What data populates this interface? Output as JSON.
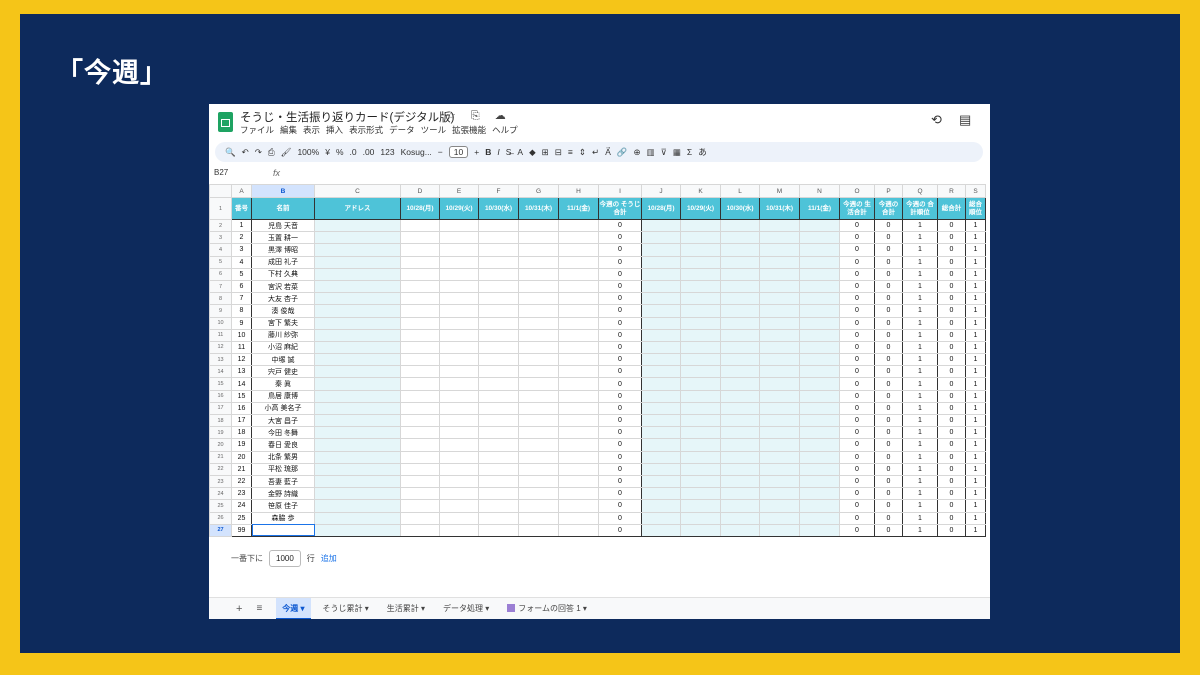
{
  "slide": {
    "title": "「今週」"
  },
  "doc": {
    "title": "そうじ・生活振り返りカード(デジタル版)",
    "title_icons": "☆ ⎘ ☁"
  },
  "menu": [
    "ファイル",
    "編集",
    "表示",
    "挿入",
    "表示形式",
    "データ",
    "ツール",
    "拡張機能",
    "ヘルプ"
  ],
  "toolbar": {
    "search": "🔍",
    "undo": "↶",
    "redo": "↷",
    "print": "⎙",
    "paint": "🖌",
    "zoom": "100%",
    "currency": "¥",
    "percent": "%",
    "dec_minus": ".0",
    "dec_plus": ".00",
    "num_fmt": "123",
    "font": "Kosug...",
    "minus": "−",
    "font_size": "10",
    "plus": "+",
    "bold": "B",
    "italic": "I",
    "strike": "S̶",
    "text_color": "A",
    "fill": "◆",
    "borders": "⊞",
    "merge": "⊟",
    "align": "≡",
    "valign": "⇕",
    "wrap": "↵",
    "rotate": "A⃗",
    "link": "🔗",
    "comment": "⊕",
    "chart": "▥",
    "filter": "⊽",
    "views": "▦",
    "sum": "Σ",
    "ime": "あ"
  },
  "namebox": "B27",
  "fx": "fx",
  "columns": [
    "A",
    "B",
    "C",
    "D",
    "E",
    "F",
    "G",
    "H",
    "I",
    "J",
    "K",
    "L",
    "M",
    "N",
    "O",
    "P",
    "Q",
    "R",
    "S"
  ],
  "headers": [
    "番号",
    "名前",
    "アドレス",
    "10/28(月)",
    "10/29(火)",
    "10/30(水)",
    "10/31(木)",
    "11/1(金)",
    "今週の そうじ合計",
    "10/28(月)",
    "10/29(火)",
    "10/30(水)",
    "10/31(木)",
    "11/1(金)",
    "今週の 生活合計",
    "今週の 合計",
    "今週の 合計順位",
    "総合計",
    "総合 順位"
  ],
  "rows": [
    {
      "rn": "2",
      "no": "1",
      "name": "児島 天音",
      "cl": "0",
      "lf": "0",
      "tot": "0",
      "rank": "1",
      "gt": "0",
      "grank": "1"
    },
    {
      "rn": "3",
      "no": "2",
      "name": "玉置 耕一",
      "cl": "0",
      "lf": "0",
      "tot": "0",
      "rank": "1",
      "gt": "0",
      "grank": "1"
    },
    {
      "rn": "4",
      "no": "3",
      "name": "黒澤 博昭",
      "cl": "0",
      "lf": "0",
      "tot": "0",
      "rank": "1",
      "gt": "0",
      "grank": "1"
    },
    {
      "rn": "5",
      "no": "4",
      "name": "成田 礼子",
      "cl": "0",
      "lf": "0",
      "tot": "0",
      "rank": "1",
      "gt": "0",
      "grank": "1"
    },
    {
      "rn": "6",
      "no": "5",
      "name": "下村 久典",
      "cl": "0",
      "lf": "0",
      "tot": "0",
      "rank": "1",
      "gt": "0",
      "grank": "1"
    },
    {
      "rn": "7",
      "no": "6",
      "name": "宮沢 若菜",
      "cl": "0",
      "lf": "0",
      "tot": "0",
      "rank": "1",
      "gt": "0",
      "grank": "1"
    },
    {
      "rn": "8",
      "no": "7",
      "name": "大友 杏子",
      "cl": "0",
      "lf": "0",
      "tot": "0",
      "rank": "1",
      "gt": "0",
      "grank": "1"
    },
    {
      "rn": "9",
      "no": "8",
      "name": "湊 俊哉",
      "cl": "0",
      "lf": "0",
      "tot": "0",
      "rank": "1",
      "gt": "0",
      "grank": "1"
    },
    {
      "rn": "10",
      "no": "9",
      "name": "宮下 繁夫",
      "cl": "0",
      "lf": "0",
      "tot": "0",
      "rank": "1",
      "gt": "0",
      "grank": "1"
    },
    {
      "rn": "11",
      "no": "10",
      "name": "藤川 紗弥",
      "cl": "0",
      "lf": "0",
      "tot": "0",
      "rank": "1",
      "gt": "0",
      "grank": "1"
    },
    {
      "rn": "12",
      "no": "11",
      "name": "小沼 麻紀",
      "cl": "0",
      "lf": "0",
      "tot": "0",
      "rank": "1",
      "gt": "0",
      "grank": "1"
    },
    {
      "rn": "13",
      "no": "12",
      "name": "中塚 誠",
      "cl": "0",
      "lf": "0",
      "tot": "0",
      "rank": "1",
      "gt": "0",
      "grank": "1"
    },
    {
      "rn": "14",
      "no": "13",
      "name": "宍戸 健史",
      "cl": "0",
      "lf": "0",
      "tot": "0",
      "rank": "1",
      "gt": "0",
      "grank": "1"
    },
    {
      "rn": "15",
      "no": "14",
      "name": "秦 眞",
      "cl": "0",
      "lf": "0",
      "tot": "0",
      "rank": "1",
      "gt": "0",
      "grank": "1"
    },
    {
      "rn": "16",
      "no": "15",
      "name": "鳥居 康博",
      "cl": "0",
      "lf": "0",
      "tot": "0",
      "rank": "1",
      "gt": "0",
      "grank": "1"
    },
    {
      "rn": "17",
      "no": "16",
      "name": "小高 美名子",
      "cl": "0",
      "lf": "0",
      "tot": "0",
      "rank": "1",
      "gt": "0",
      "grank": "1"
    },
    {
      "rn": "18",
      "no": "17",
      "name": "大宮 昌子",
      "cl": "0",
      "lf": "0",
      "tot": "0",
      "rank": "1",
      "gt": "0",
      "grank": "1"
    },
    {
      "rn": "19",
      "no": "18",
      "name": "今田 冬舞",
      "cl": "0",
      "lf": "0",
      "tot": "0",
      "rank": "1",
      "gt": "0",
      "grank": "1"
    },
    {
      "rn": "20",
      "no": "19",
      "name": "春日 愛良",
      "cl": "0",
      "lf": "0",
      "tot": "0",
      "rank": "1",
      "gt": "0",
      "grank": "1"
    },
    {
      "rn": "21",
      "no": "20",
      "name": "北条 繁男",
      "cl": "0",
      "lf": "0",
      "tot": "0",
      "rank": "1",
      "gt": "0",
      "grank": "1"
    },
    {
      "rn": "22",
      "no": "21",
      "name": "平松 琉那",
      "cl": "0",
      "lf": "0",
      "tot": "0",
      "rank": "1",
      "gt": "0",
      "grank": "1"
    },
    {
      "rn": "23",
      "no": "22",
      "name": "吾妻 藍子",
      "cl": "0",
      "lf": "0",
      "tot": "0",
      "rank": "1",
      "gt": "0",
      "grank": "1"
    },
    {
      "rn": "24",
      "no": "23",
      "name": "金野 詩織",
      "cl": "0",
      "lf": "0",
      "tot": "0",
      "rank": "1",
      "gt": "0",
      "grank": "1"
    },
    {
      "rn": "25",
      "no": "24",
      "name": "笹原 佳子",
      "cl": "0",
      "lf": "0",
      "tot": "0",
      "rank": "1",
      "gt": "0",
      "grank": "1"
    },
    {
      "rn": "26",
      "no": "25",
      "name": "森脇 歩",
      "cl": "0",
      "lf": "0",
      "tot": "0",
      "rank": "1",
      "gt": "0",
      "grank": "1"
    },
    {
      "rn": "27",
      "no": "99",
      "name": "",
      "cl": "0",
      "lf": "0",
      "tot": "0",
      "rank": "1",
      "gt": "0",
      "grank": "1"
    }
  ],
  "add_rows": {
    "prefix": "一番下に",
    "count": "1000",
    "unit": "行",
    "action": "追加"
  },
  "tabs": {
    "add": "+",
    "list": "≡",
    "items": [
      {
        "label": "今週 ▾",
        "active": true
      },
      {
        "label": "そうじ累計 ▾"
      },
      {
        "label": "生活累計 ▾"
      },
      {
        "label": "データ処理 ▾"
      },
      {
        "label": "フォームの回答 1 ▾",
        "icon": true
      }
    ]
  },
  "colors": {
    "border": "#f5c518",
    "background": "#0d2a5c",
    "header_cyan": "#4ec3d8",
    "tint": "#e6f6f9"
  }
}
